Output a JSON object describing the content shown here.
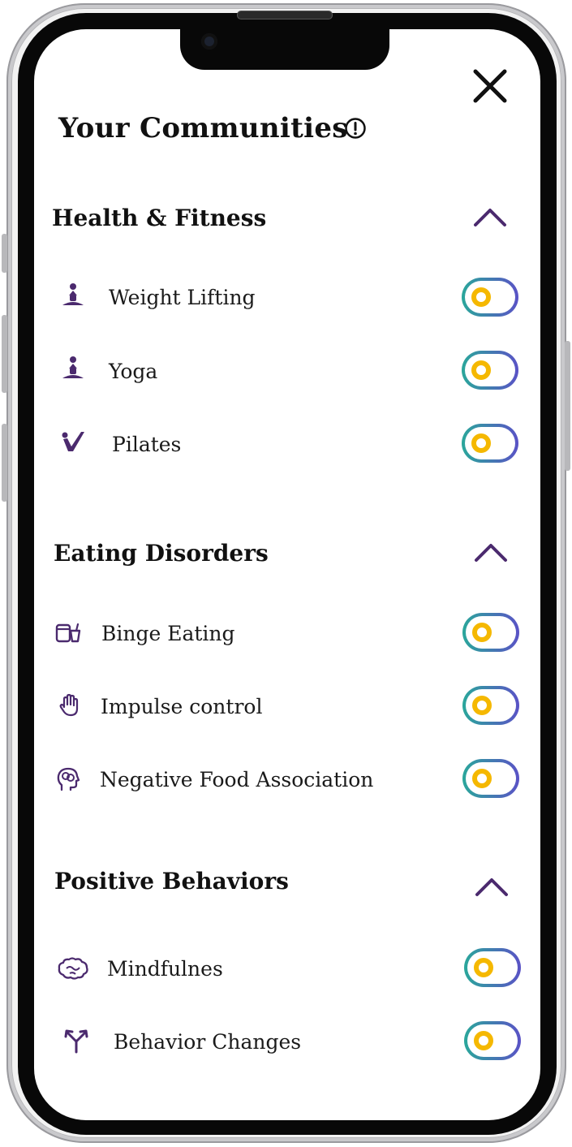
{
  "header": {
    "title": "Your Communities",
    "close_icon": "close-icon",
    "info_icon": "info-icon"
  },
  "colors": {
    "accent_purple": "#4b2a6e",
    "toggle_gradient_start": "#2aa79b",
    "toggle_gradient_end": "#5a52c6",
    "toggle_knob": "#f5b800"
  },
  "sections": [
    {
      "title": "Health & Fitness",
      "expanded": true,
      "items": [
        {
          "label": "Weight Lifting",
          "icon": "meditation-icon",
          "enabled": false
        },
        {
          "label": "Yoga",
          "icon": "meditation-icon",
          "enabled": false
        },
        {
          "label": "Pilates",
          "icon": "pilates-icon",
          "enabled": false
        }
      ]
    },
    {
      "title": "Eating Disorders",
      "expanded": true,
      "items": [
        {
          "label": "Binge Eating",
          "icon": "food-container-icon",
          "enabled": false
        },
        {
          "label": "Impulse control",
          "icon": "hand-icon",
          "enabled": false
        },
        {
          "label": "Negative Food Association",
          "icon": "head-brain-icon",
          "enabled": false
        }
      ]
    },
    {
      "title": "Positive Behaviors",
      "expanded": true,
      "items": [
        {
          "label": "Mindfulnes",
          "icon": "brain-icon",
          "enabled": false
        },
        {
          "label": "Behavior Changes",
          "icon": "branch-arrows-icon",
          "enabled": false
        }
      ]
    }
  ]
}
